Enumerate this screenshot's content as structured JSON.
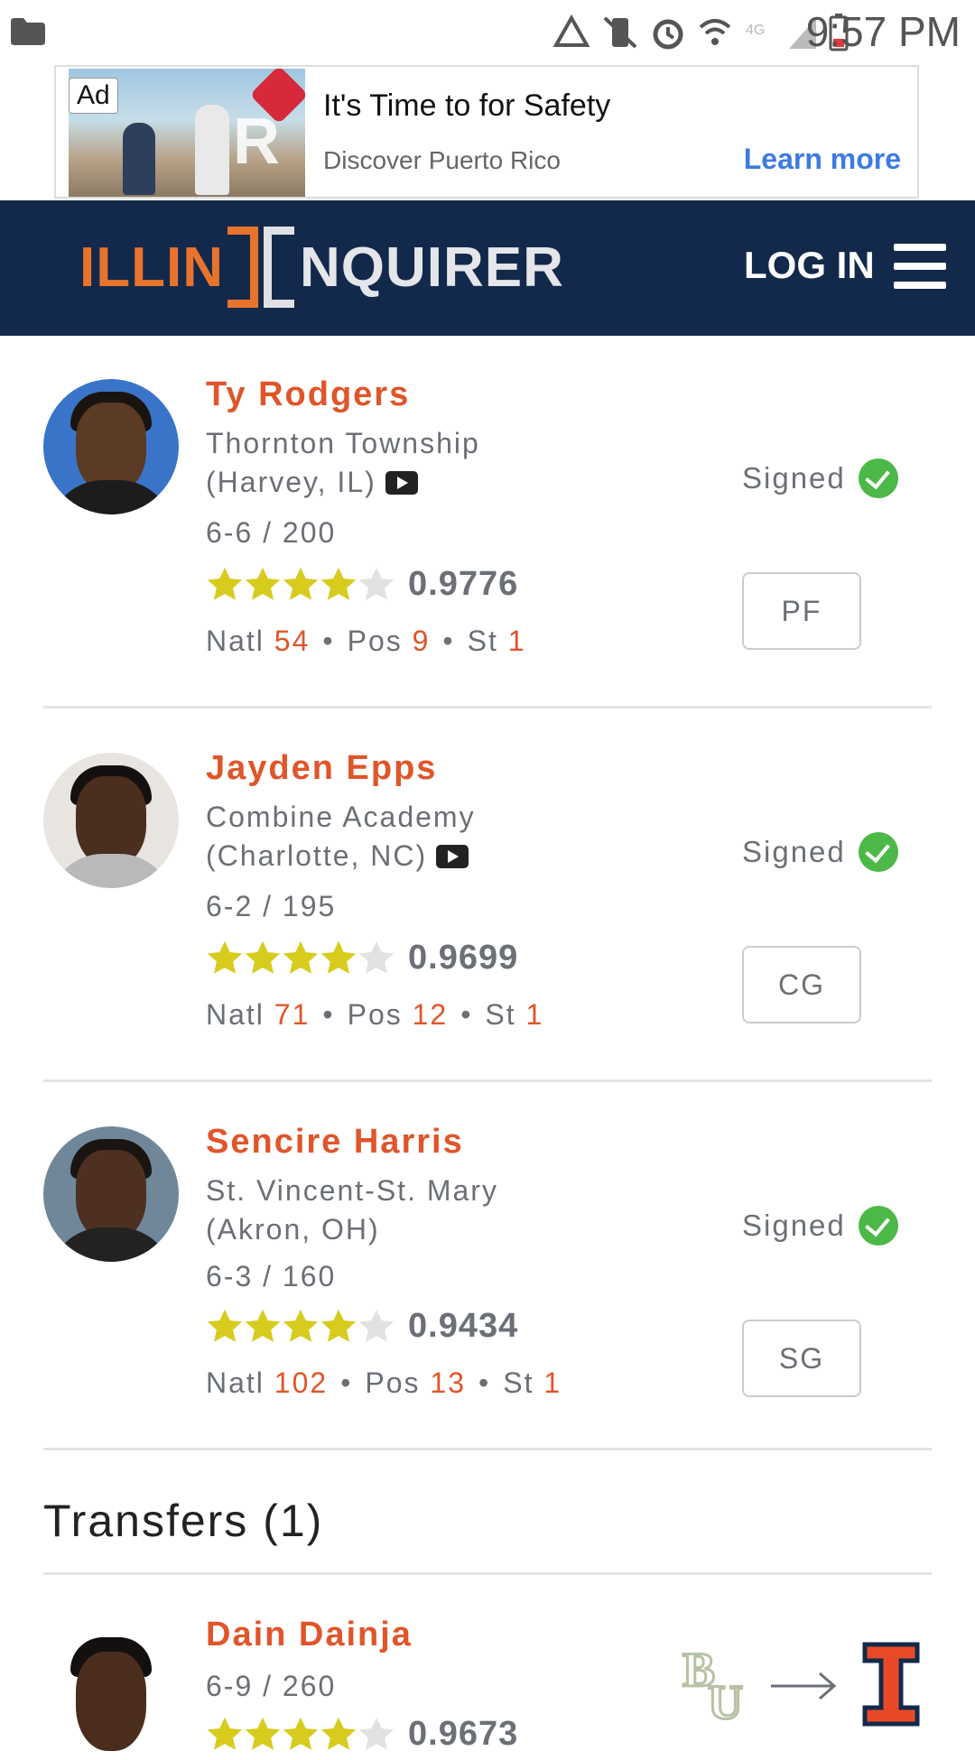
{
  "status_bar": {
    "time": "9:57 PM",
    "icons": [
      "folder-icon",
      "recycle-icon",
      "vibrate-mute-icon",
      "alarm-icon",
      "wifi-icon",
      "lte-icon",
      "signal-icon",
      "battery-low-icon"
    ]
  },
  "ad": {
    "badge": "Ad",
    "title": "It's Time to for Safety",
    "subtitle": "Discover Puerto Rico",
    "cta": "Learn more"
  },
  "header": {
    "logo_left": "ILLIN",
    "logo_right": "NQUIRER",
    "login": "LOG IN",
    "colors": {
      "navy": "#13294b",
      "orange": "#e8742c"
    }
  },
  "recruits": [
    {
      "name": "Ty Rodgers",
      "school_line1": "Thornton Township",
      "school_line2": "(Harvey, IL)",
      "has_video": true,
      "height_weight": "6-6 / 200",
      "stars": 4,
      "rating": "0.9776",
      "natl_label": "Natl",
      "natl": "54",
      "pos_label": "Pos",
      "pos_rank": "9",
      "st_label": "St",
      "st": "1",
      "status": "Signed",
      "position": "PF"
    },
    {
      "name": "Jayden Epps",
      "school_line1": "Combine Academy",
      "school_line2": "(Charlotte, NC)",
      "has_video": true,
      "height_weight": "6-2 / 195",
      "stars": 4,
      "rating": "0.9699",
      "natl_label": "Natl",
      "natl": "71",
      "pos_label": "Pos",
      "pos_rank": "12",
      "st_label": "St",
      "st": "1",
      "status": "Signed",
      "position": "CG"
    },
    {
      "name": "Sencire Harris",
      "school_line1": "St. Vincent-St. Mary",
      "school_line2": "(Akron, OH)",
      "has_video": false,
      "height_weight": "6-3 / 160",
      "stars": 4,
      "rating": "0.9434",
      "natl_label": "Natl",
      "natl": "102",
      "pos_label": "Pos",
      "pos_rank": "13",
      "st_label": "St",
      "st": "1",
      "status": "Signed",
      "position": "SG"
    }
  ],
  "transfers": {
    "heading": "Transfers (1)",
    "items": [
      {
        "name": "Dain Dainja",
        "height_weight": "6-9 / 260",
        "stars": 4,
        "rating": "0.9673",
        "from_logo": "baylor-logo",
        "to_logo": "illinois-logo"
      }
    ]
  }
}
